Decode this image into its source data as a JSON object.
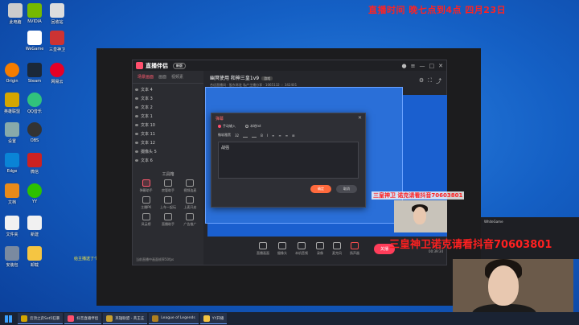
{
  "overlay": {
    "top_text": "直播时间 晚七点到4点 四月23日",
    "promo_small": "三皇神卫 诺克请看抖音70603801",
    "promo_large": "三皇神卫诺克请看抖音70603801"
  },
  "desktop": {
    "icons": [
      {
        "label": "此电脑"
      },
      {
        "label": "NVIDIA"
      },
      {
        "label": "回收站"
      },
      {
        "label": "WeGame"
      },
      {
        "label": "三皇神卫"
      },
      {
        "label": "Origin"
      },
      {
        "label": "Steam"
      },
      {
        "label": "网易云"
      },
      {
        "label": "英雄联盟"
      },
      {
        "label": "QQ音乐"
      },
      {
        "label": "设置"
      },
      {
        "label": "OBS"
      },
      {
        "label": "Edge"
      },
      {
        "label": "微信"
      },
      {
        "label": "文档"
      },
      {
        "label": "YY"
      },
      {
        "label": "文件夹"
      },
      {
        "label": "新建"
      },
      {
        "label": "安装包"
      },
      {
        "label": "卸载"
      }
    ],
    "chat_line": "给主播送了个宫植歌"
  },
  "app": {
    "name": "直播伴侣",
    "badge": "新版",
    "tabs": [
      "场景画面",
      "画面",
      "视频素"
    ],
    "sources": [
      "文本 4",
      "文本 3",
      "文本 2",
      "文本 1",
      "文本 10",
      "文本 11",
      "文本 12",
      "摄像头 5",
      "文本 6"
    ],
    "tools_title": "工具箱",
    "tools": [
      "弹幕助手",
      "房管助手",
      "视频连麦",
      "主播PK",
      "上车一起玩",
      "上麦开启",
      "风云榜",
      "直播助手",
      "广告推广",
      "",
      "",
      ""
    ],
    "left_footer": "当前直播中画面帧率50fps",
    "room_title": "幽冥使用 和神三皇1v9",
    "room_chip": "游戏",
    "room_meta": "合适直播间 · 股东常驻    私产主播分享 · 1065132    ♢ 342401",
    "bottom_items": [
      "直播画面",
      "摄像头",
      "本机音频",
      "录像",
      "麦克风",
      "扬声器"
    ],
    "live_btn": "关播",
    "time": "00:39:34"
  },
  "dialog": {
    "title": "弹幕",
    "radio_1": "手动输入",
    "radio_2": "本地txt",
    "font": "微软雅黑",
    "size": "32",
    "text": "战强",
    "ok": "确定",
    "cancel": "取消"
  },
  "side_panel": {
    "title": "WhiteGame"
  },
  "taskbar": {
    "tasks": [
      {
        "label": "云顶之弈Set5狂暴"
      },
      {
        "label": "抖音直播伴侣"
      },
      {
        "label": "英雄联盟 - 英王庄"
      },
      {
        "label": "League of Legends"
      },
      {
        "label": "YY开播"
      }
    ]
  },
  "colors": {
    "accent": "#ff4f6d",
    "promo_red": "#ff2020",
    "desktop_blue": "#1a5fcf"
  }
}
